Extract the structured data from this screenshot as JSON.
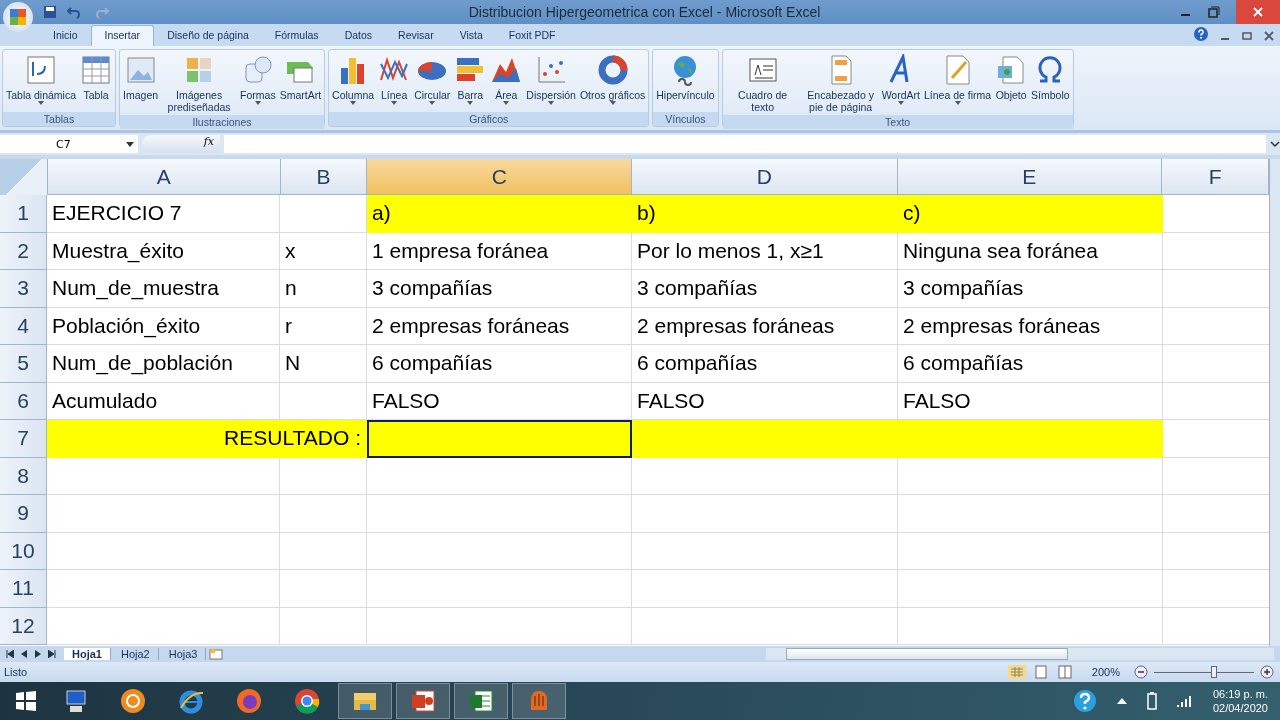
{
  "window": {
    "title": "Distribucion Hipergeometrica con Excel - Microsoft Excel"
  },
  "tabs": [
    {
      "label": "Inicio",
      "selected": false
    },
    {
      "label": "Insertar",
      "selected": true
    },
    {
      "label": "Diseño de página",
      "selected": false
    },
    {
      "label": "Fórmulas",
      "selected": false
    },
    {
      "label": "Datos",
      "selected": false
    },
    {
      "label": "Revisar",
      "selected": false
    },
    {
      "label": "Vista",
      "selected": false
    },
    {
      "label": "Foxit PDF",
      "selected": false
    }
  ],
  "ribbon": [
    {
      "name": "Tablas",
      "buttons": [
        {
          "label": "Tabla dinámica",
          "menu": true
        },
        {
          "label": "Tabla",
          "menu": false
        }
      ]
    },
    {
      "name": "Ilustraciones",
      "buttons": [
        {
          "label": "Imagen",
          "menu": false
        },
        {
          "label": "Imágenes prediseñadas",
          "menu": false
        },
        {
          "label": "Formas",
          "menu": true
        },
        {
          "label": "SmartArt",
          "menu": false
        }
      ]
    },
    {
      "name": "Gráficos",
      "buttons": [
        {
          "label": "Columna",
          "menu": true
        },
        {
          "label": "Línea",
          "menu": true
        },
        {
          "label": "Circular",
          "menu": true
        },
        {
          "label": "Barra",
          "menu": true
        },
        {
          "label": "Área",
          "menu": true
        },
        {
          "label": "Dispersión",
          "menu": true
        },
        {
          "label": "Otros gráficos",
          "menu": true
        }
      ]
    },
    {
      "name": "Vínculos",
      "buttons": [
        {
          "label": "Hipervínculo",
          "menu": false
        }
      ]
    },
    {
      "name": "Texto",
      "buttons": [
        {
          "label": "Cuadro de texto",
          "menu": false
        },
        {
          "label": "Encabezado y pie de página",
          "menu": false
        },
        {
          "label": "WordArt",
          "menu": true
        },
        {
          "label": "Línea de firma",
          "menu": true
        },
        {
          "label": "Objeto",
          "menu": false
        },
        {
          "label": "Símbolo",
          "menu": false
        }
      ]
    }
  ],
  "name_box": "C7",
  "function_label": "fx",
  "columns": [
    {
      "label": "A",
      "selected": false
    },
    {
      "label": "B",
      "selected": false
    },
    {
      "label": "C",
      "selected": true
    },
    {
      "label": "D",
      "selected": false
    },
    {
      "label": "E",
      "selected": false
    },
    {
      "label": "F",
      "selected": false
    }
  ],
  "rows": [
    {
      "number": "1",
      "cells": [
        {
          "text": "EJERCICIO 7"
        },
        {
          "text": ""
        },
        {
          "text": "a)",
          "fill": true
        },
        {
          "text": "b)",
          "fill": true
        },
        {
          "text": "c)",
          "fill": true
        },
        {
          "text": ""
        }
      ]
    },
    {
      "number": "2",
      "cells": [
        {
          "text": "Muestra_éxito"
        },
        {
          "text": "x"
        },
        {
          "text": "1 empresa foránea"
        },
        {
          "text": "Por lo menos 1, x≥1"
        },
        {
          "text": "Ninguna sea foránea"
        },
        {
          "text": ""
        }
      ]
    },
    {
      "number": "3",
      "cells": [
        {
          "text": "Num_de_muestra"
        },
        {
          "text": "n"
        },
        {
          "text": "3 compañías"
        },
        {
          "text": "3 compañías"
        },
        {
          "text": "3 compañías"
        },
        {
          "text": ""
        }
      ]
    },
    {
      "number": "4",
      "cells": [
        {
          "text": "Población_éxito"
        },
        {
          "text": "r"
        },
        {
          "text": "2 empresas foráneas"
        },
        {
          "text": "2 empresas foráneas"
        },
        {
          "text": "2 empresas foráneas"
        },
        {
          "text": ""
        }
      ]
    },
    {
      "number": "5",
      "cells": [
        {
          "text": "Num_de_población"
        },
        {
          "text": "N"
        },
        {
          "text": "6 compañías"
        },
        {
          "text": "6 compañías"
        },
        {
          "text": "6 compañías"
        },
        {
          "text": ""
        }
      ]
    },
    {
      "number": "6",
      "cells": [
        {
          "text": "Acumulado"
        },
        {
          "text": ""
        },
        {
          "text": "FALSO"
        },
        {
          "text": "FALSO"
        },
        {
          "text": "FALSO"
        },
        {
          "text": ""
        }
      ]
    },
    {
      "number": "7",
      "cells": [
        {
          "text": "RESULTADO :",
          "fill": true,
          "merged": true
        },
        {
          "text": "",
          "fill": true,
          "active": true
        },
        {
          "text": "",
          "fill": true
        },
        {
          "text": "",
          "fill": true
        },
        {
          "text": ""
        }
      ]
    },
    {
      "number": "8",
      "cells": []
    },
    {
      "number": "9",
      "cells": []
    },
    {
      "number": "10",
      "cells": []
    },
    {
      "number": "11",
      "cells": []
    },
    {
      "number": "12",
      "cells": []
    }
  ],
  "sheets": [
    {
      "label": "Hoja1",
      "selected": true
    },
    {
      "label": "Hoja2",
      "selected": false
    },
    {
      "label": "Hoja3",
      "selected": false
    }
  ],
  "status_bar": {
    "text": "Listo",
    "zoom": "200%",
    "level": 0.6
  },
  "taskbar": {
    "apps": [
      {
        "open": false
      },
      {
        "open": false
      },
      {
        "open": false
      },
      {
        "open": false
      },
      {
        "open": false
      },
      {
        "open": true
      },
      {
        "open": true
      },
      {
        "open": true
      },
      {
        "open": true
      }
    ],
    "time": "06:19 p. m.",
    "date": "02/04/2020"
  }
}
